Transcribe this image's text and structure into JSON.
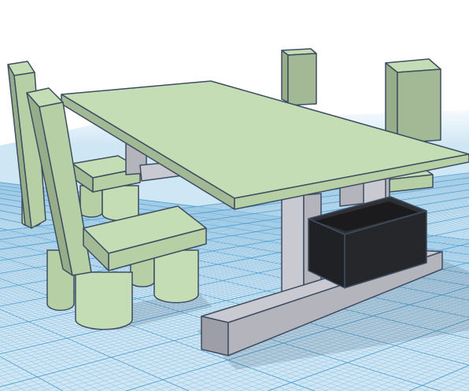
{
  "workplane": {
    "background": "#ffffff",
    "grid_fill": "#cfe6f4",
    "grid_minor": "#9cc8e4",
    "grid_major": "#5aa6d4"
  },
  "materials": {
    "green_top": "#c4ddb4",
    "green_front": "#b6cfa4",
    "green_side": "#a3b996",
    "green_dark": "#97ad8a",
    "grey_light": "#c9c9d1",
    "grey_mid": "#b4b4bd",
    "grey_dark": "#9e9ea8",
    "box_front": "#26272b",
    "box_inner": "#1b1b1e",
    "edge": "#3e4d60"
  }
}
